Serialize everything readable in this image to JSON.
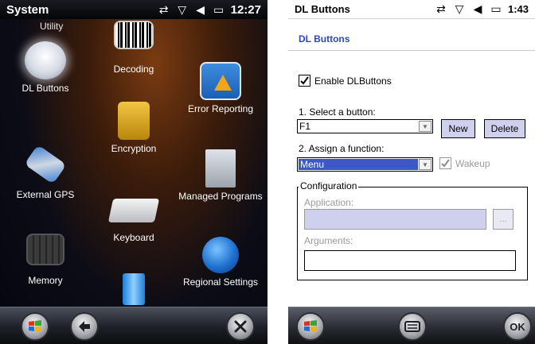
{
  "left": {
    "status": {
      "title": "System",
      "time": "12:27"
    },
    "cut_labels": {
      "top_left": "Utility",
      "top_right": ""
    },
    "items": [
      {
        "label": "Decoding"
      },
      {
        "label": "DL Buttons"
      },
      {
        "label": "Error Reporting"
      },
      {
        "label": "Encryption"
      },
      {
        "label": "External GPS"
      },
      {
        "label": "Managed Programs"
      },
      {
        "label": "Keyboard"
      },
      {
        "label": "Memory"
      },
      {
        "label": "Regional Settings"
      }
    ],
    "taskbar": {
      "start_icon": "windows-flag",
      "back_icon": "back-arrow",
      "close_icon": "close-x"
    }
  },
  "right": {
    "status": {
      "title": "DL Buttons",
      "time": "1:43"
    },
    "page_title": "DL Buttons",
    "enable_label": "Enable DLButtons",
    "enable_checked": true,
    "select_label": "1. Select a button:",
    "button_value": "F1",
    "new_label": "New",
    "delete_label": "Delete",
    "assign_label": "2. Assign a function:",
    "function_value": "Menu",
    "wakeup_label": "Wakeup",
    "wakeup_checked": true,
    "config_label": "Configuration",
    "application_label": "Application:",
    "application_value": "",
    "browse_label": "...",
    "arguments_label": "Arguments:",
    "arguments_value": "",
    "taskbar": {
      "ok_label": "OK"
    }
  },
  "colors": {
    "title_blue": "#2b4bb3",
    "selection_blue": "#3b58c6",
    "button_lavender": "#cfd0ee"
  }
}
